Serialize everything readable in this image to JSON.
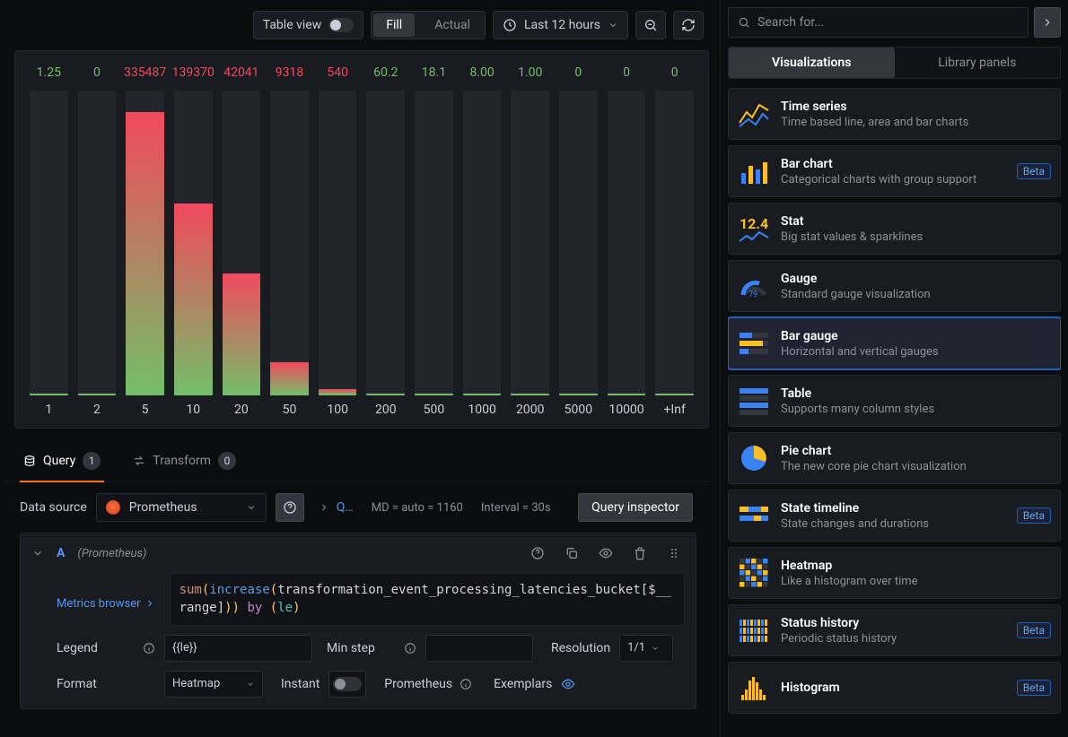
{
  "toolbar": {
    "table_view_label": "Table view",
    "fill_label": "Fill",
    "actual_label": "Actual",
    "time_range_label": "Last 12 hours"
  },
  "chart_data": {
    "type": "bar",
    "title": "",
    "categories": [
      "1",
      "2",
      "5",
      "10",
      "20",
      "50",
      "100",
      "200",
      "500",
      "1000",
      "2000",
      "5000",
      "10000",
      "+Inf"
    ],
    "values": [
      1.25,
      0,
      335487,
      139370,
      42041,
      9318,
      540,
      60.2,
      18.1,
      8.0,
      1.0,
      0,
      0,
      0
    ],
    "display_values": [
      "1.25",
      "0",
      "335487",
      "139370",
      "42041",
      "9318",
      "540",
      "60.2",
      "18.1",
      "8.00",
      "1.00",
      "0",
      "0",
      "0"
    ],
    "value_colors": [
      "green",
      "green",
      "red",
      "red",
      "red",
      "red",
      "red",
      "green",
      "green",
      "green",
      "green",
      "green",
      "green",
      "green"
    ],
    "bar_height_pct": [
      0,
      0,
      93,
      63,
      40,
      11,
      2,
      0,
      0,
      0,
      0,
      0,
      0,
      0
    ],
    "xlabel": "",
    "ylabel": "",
    "ylim": [
      0,
      360000
    ]
  },
  "tabs": {
    "query_label": "Query",
    "query_count": "1",
    "transform_label": "Transform",
    "transform_count": "0"
  },
  "query_header": {
    "data_source_label": "Data source",
    "data_source_value": "Prometheus",
    "options_label": "Q…",
    "md_text": "MD = auto = 1160",
    "interval_text": "Interval = 30s",
    "inspector_label": "Query inspector"
  },
  "query": {
    "ref": "A",
    "ds_hint": "(Prometheus)",
    "metrics_browser_label": "Metrics browser",
    "expr_display": "sum(increase(transformation_event_processing_latencies_bucket[$__range])) by (le)",
    "legend_label": "Legend",
    "legend_value": "{{le}}",
    "min_step_label": "Min step",
    "min_step_value": "",
    "resolution_label": "Resolution",
    "resolution_value": "1/1",
    "format_label": "Format",
    "format_value": "Heatmap",
    "instant_label": "Instant",
    "prometheus_label": "Prometheus",
    "exemplars_label": "Exemplars"
  },
  "sidebar": {
    "search_placeholder": "Search for...",
    "tab_visualizations": "Visualizations",
    "tab_library": "Library panels",
    "items": [
      {
        "title": "Time series",
        "desc": "Time based line, area and bar charts",
        "beta": false,
        "selected": false
      },
      {
        "title": "Bar chart",
        "desc": "Categorical charts with group support",
        "beta": true,
        "selected": false
      },
      {
        "title": "Stat",
        "desc": "Big stat values & sparklines",
        "beta": false,
        "selected": false
      },
      {
        "title": "Gauge",
        "desc": "Standard gauge visualization",
        "beta": false,
        "selected": false
      },
      {
        "title": "Bar gauge",
        "desc": "Horizontal and vertical gauges",
        "beta": false,
        "selected": true
      },
      {
        "title": "Table",
        "desc": "Supports many column styles",
        "beta": false,
        "selected": false
      },
      {
        "title": "Pie chart",
        "desc": "The new core pie chart visualization",
        "beta": false,
        "selected": false
      },
      {
        "title": "State timeline",
        "desc": "State changes and durations",
        "beta": true,
        "selected": false
      },
      {
        "title": "Heatmap",
        "desc": "Like a histogram over time",
        "beta": false,
        "selected": false
      },
      {
        "title": "Status history",
        "desc": "Periodic status history",
        "beta": true,
        "selected": false
      },
      {
        "title": "Histogram",
        "desc": "",
        "beta": true,
        "selected": false
      }
    ]
  },
  "colors": {
    "accent": "#f8771b",
    "blue": "#1f60c4"
  }
}
